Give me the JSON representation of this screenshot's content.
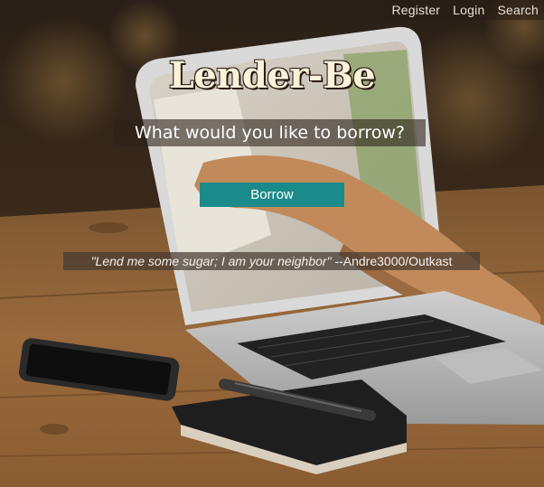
{
  "nav": {
    "links": [
      "Register",
      "Login",
      "Search"
    ]
  },
  "hero": {
    "logo": "Lender-Be",
    "tagline": "What would you like to borrow?",
    "borrow_label": "Borrow",
    "quote_text": "\"Lend me some sugar; I am your neighbor\"",
    "quote_attribution": " --Andre3000/Outkast"
  },
  "colors": {
    "accent": "#1b8a8a"
  }
}
